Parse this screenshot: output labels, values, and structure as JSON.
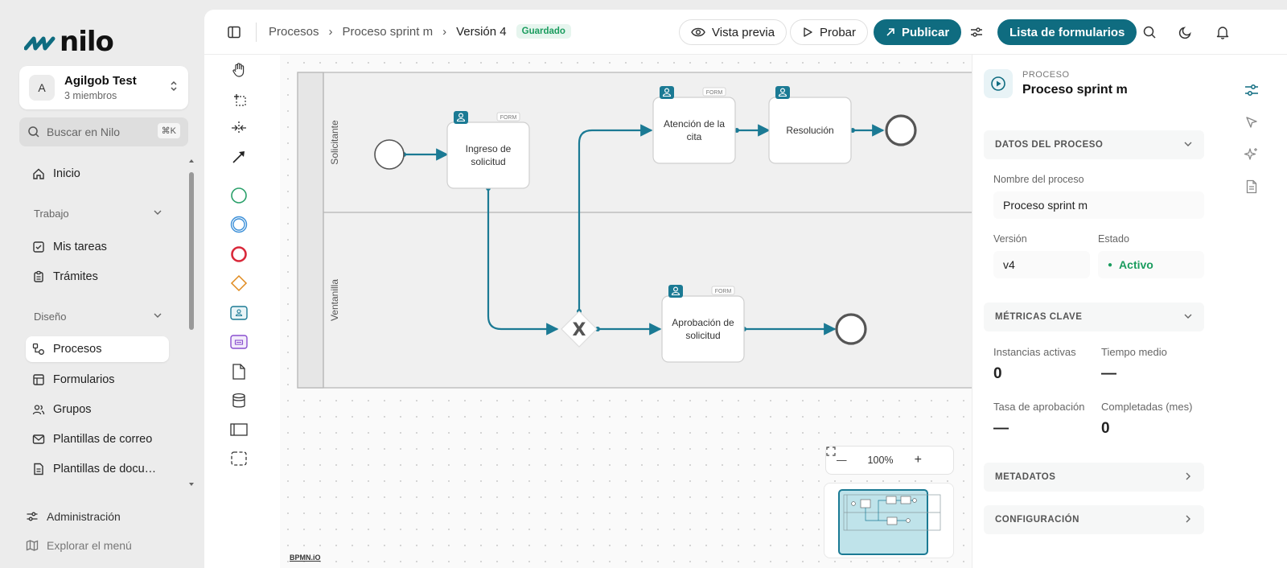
{
  "brand": {
    "name": "nilo",
    "accent": "#0f6c80"
  },
  "org": {
    "initial": "A",
    "name": "Agilgob Test",
    "members": "3 miembros"
  },
  "search": {
    "placeholder": "Buscar en Nilo",
    "shortcut": "⌘K"
  },
  "nav": {
    "home": "Inicio",
    "section_work": "Trabajo",
    "tasks": "Mis tareas",
    "procedures": "Trámites",
    "section_design": "Diseño",
    "processes": "Procesos",
    "forms": "Formularios",
    "groups": "Grupos",
    "email_templates": "Plantillas de correo",
    "doc_templates": "Plantillas de docu…",
    "admin": "Administración",
    "explore": "Explorar el menú"
  },
  "breadcrumb": {
    "root": "Procesos",
    "process": "Proceso sprint m",
    "version": "Versión 4",
    "status": "Guardado"
  },
  "toolbar": {
    "preview": "Vista previa",
    "test": "Probar",
    "publish": "Publicar",
    "form_list": "Lista de formularios"
  },
  "diagram": {
    "lanes": [
      "Solicitante",
      "Ventanilla"
    ],
    "tasks": [
      {
        "id": "t1",
        "label_lines": [
          "Ingreso de",
          "solicitud"
        ],
        "form_tag": "FORM"
      },
      {
        "id": "t2",
        "label_lines": [
          "Atención de la",
          "cita"
        ],
        "form_tag": "FORM"
      },
      {
        "id": "t3",
        "label_lines": [
          "Resolución"
        ],
        "form_tag": ""
      },
      {
        "id": "t4",
        "label_lines": [
          "Aprobación de",
          "solicitud"
        ],
        "form_tag": "FORM"
      }
    ],
    "gateway_symbol": "X",
    "flow_color": "#1b7a94"
  },
  "zoom": {
    "level": "100%"
  },
  "watermark": "BPMN.iO",
  "props": {
    "kicker": "PROCESO",
    "title": "Proceso sprint m",
    "sec_data": "DATOS DEL PROCESO",
    "name_label": "Nombre del proceso",
    "name_value": "Proceso sprint m",
    "version_label": "Versión",
    "version_value": "v4",
    "state_label": "Estado",
    "state_value": "Activo",
    "sec_metrics": "MÉTRICAS CLAVE",
    "m1_label": "Instancias activas",
    "m1_value": "0",
    "m2_label": "Tiempo medio",
    "m2_value": "—",
    "m3_label": "Tasa de aprobación",
    "m3_value": "—",
    "m4_label": "Completadas (mes)",
    "m4_value": "0",
    "sec_meta": "METADATOS",
    "sec_config": "CONFIGURACIÓN"
  }
}
